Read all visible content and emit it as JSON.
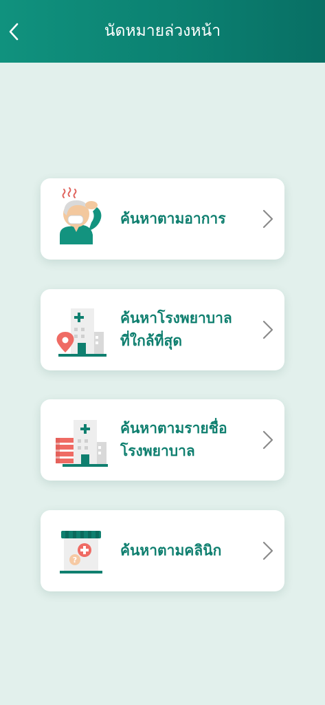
{
  "header": {
    "title": "นัดหมายล่วงหน้า",
    "back_icon": "chevron-left-icon",
    "bg_color": "#0b7f70"
  },
  "menu": {
    "items": [
      {
        "id": "symptom",
        "icon": "sick-person-icon",
        "lines": [
          "ค้นหาตามอาการ"
        ]
      },
      {
        "id": "nearest-hospital",
        "icon": "hospital-location-icon",
        "lines": [
          "ค้นหาโรงพยาบาล",
          "ที่ใกล้ที่สุด"
        ]
      },
      {
        "id": "hospital-name",
        "icon": "hospital-list-icon",
        "lines": [
          "ค้นหาตามรายชื่อ",
          "โรงพยาบาล"
        ]
      },
      {
        "id": "clinic",
        "icon": "clinic-icon",
        "lines": [
          "ค้นหาตามคลินิก"
        ]
      }
    ]
  },
  "colors": {
    "accent": "#0f7f6f",
    "background": "#e2f0ec",
    "card": "#ffffff",
    "chevron": "#8a8a8a",
    "marker": "#ef6b64"
  }
}
